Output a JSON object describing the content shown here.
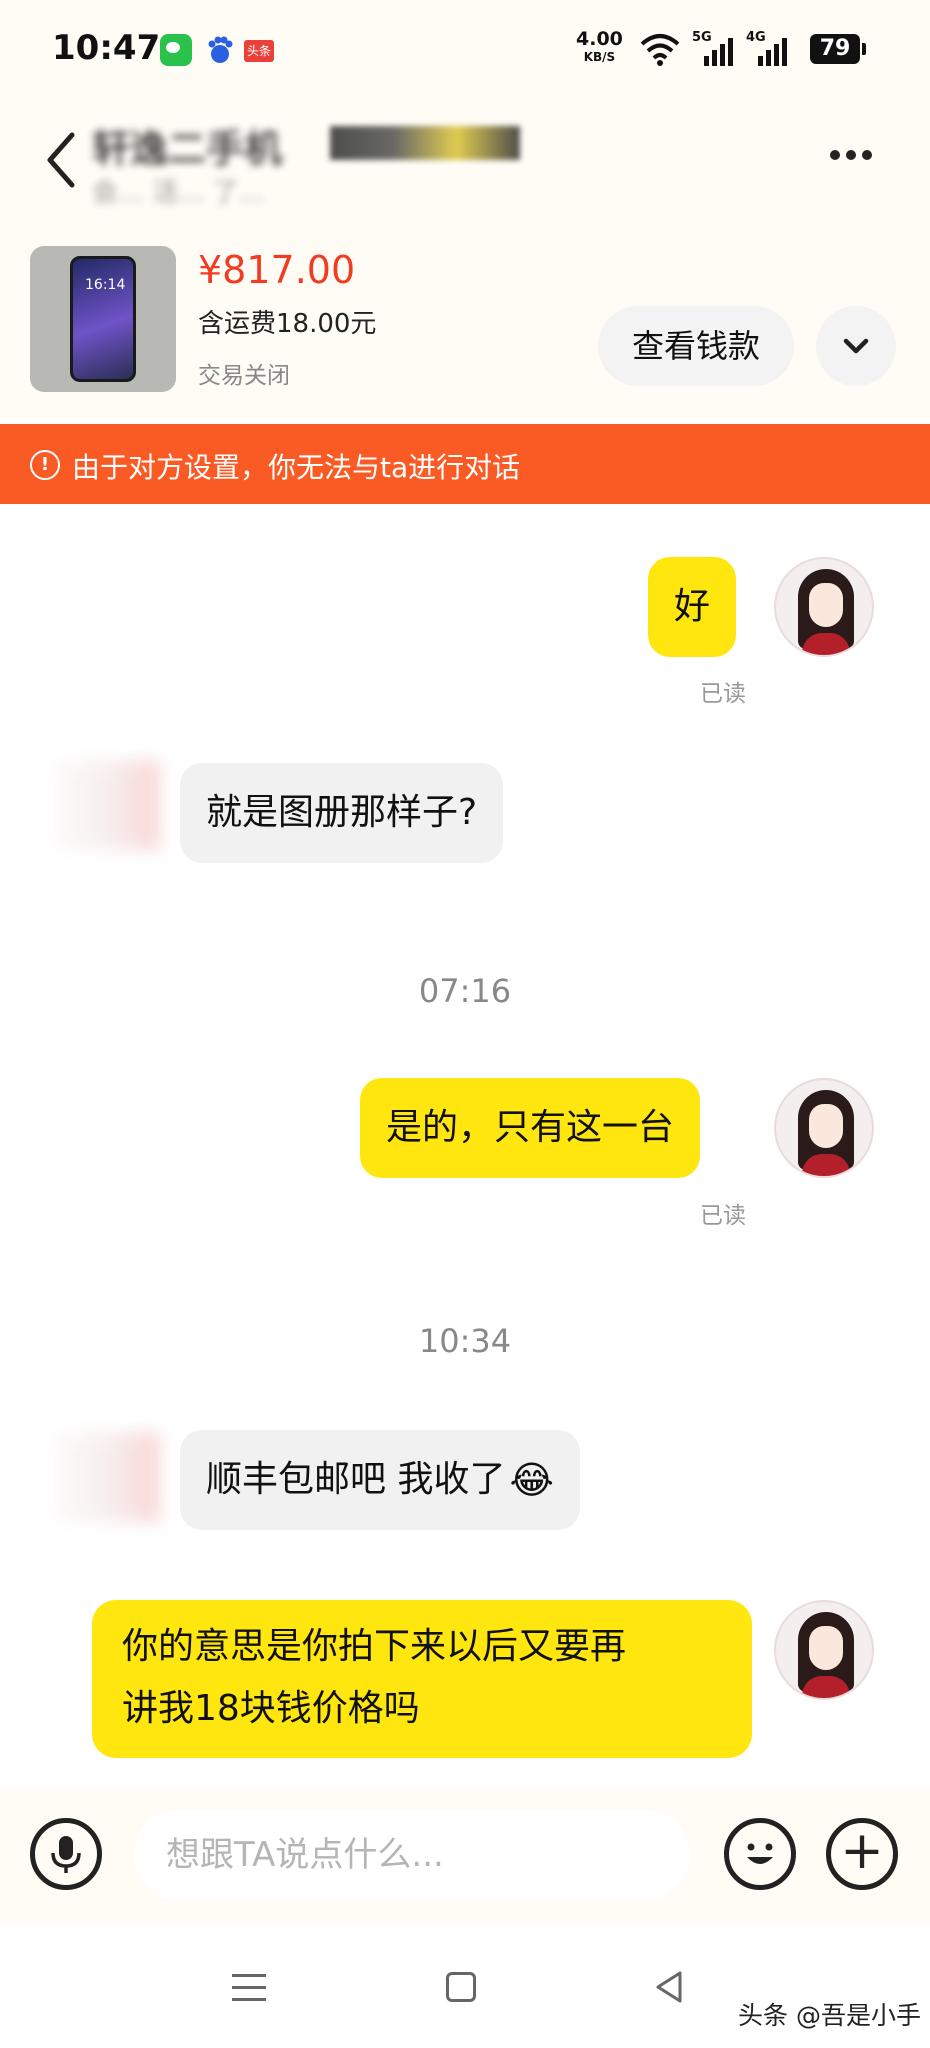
{
  "status_bar": {
    "time": "10:47",
    "net_speed": "4.00",
    "net_speed_unit": "KB/S",
    "signal_1": "5G",
    "signal_2": "4G",
    "battery": "79",
    "toutiao_badge": "头条"
  },
  "header": {
    "title": "轩逸二手机",
    "subtitle": "会… 活… 了…",
    "icons": [
      "back-icon",
      "more-icon"
    ]
  },
  "product": {
    "price": "¥817.00",
    "shipping": "含运费18.00元",
    "status": "交易关闭",
    "view_funds_label": "查看钱款",
    "thumbnail_time": "16:14"
  },
  "warning": {
    "icon": "!",
    "text": "由于对方设置，你无法与ta进行对话"
  },
  "messages": {
    "m1": {
      "text": "好",
      "read": "已读"
    },
    "m2": {
      "text": "就是图册那样子?"
    },
    "ts1": "07:16",
    "m3": {
      "text": "是的，只有这一台",
      "read": "已读"
    },
    "ts2": "10:34",
    "m4": {
      "text": "顺丰包邮吧 我收了",
      "emoji": "😂"
    },
    "m5": {
      "line1": "你的意思是你拍下来以后又要再",
      "line2": "讲我18块钱价格吗"
    }
  },
  "input_bar": {
    "placeholder": "想跟TA说点什么...",
    "plus": "+"
  },
  "nav": {
    "watermark": "头条 @吾是小手"
  },
  "colors": {
    "accent_yellow": "#ffe60f",
    "price_red": "#f23c22",
    "warning_orange": "#fa5a24"
  }
}
